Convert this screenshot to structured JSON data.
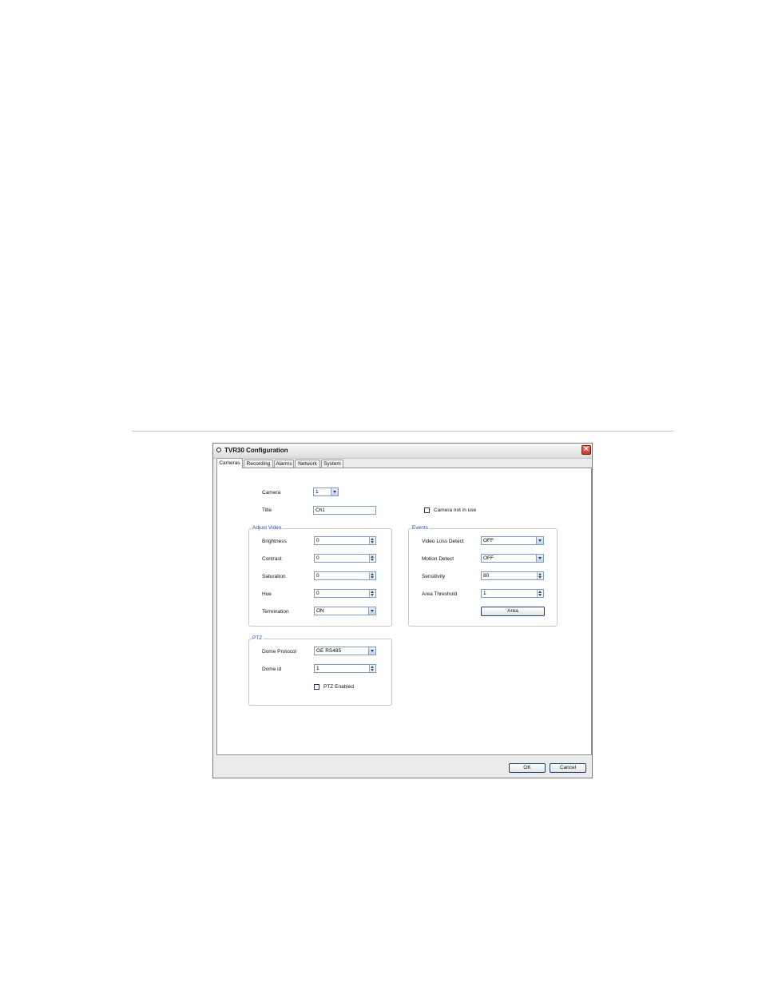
{
  "window": {
    "title": "TVR30 Configuration",
    "close_glyph": "✕"
  },
  "tabs": [
    {
      "label": "Cameras",
      "active": true
    },
    {
      "label": "Recording",
      "active": false
    },
    {
      "label": "Alarms",
      "active": false
    },
    {
      "label": "Network",
      "active": false
    },
    {
      "label": "System",
      "active": false
    }
  ],
  "camera": {
    "label": "Camera",
    "value": "1"
  },
  "title_field": {
    "label": "Title",
    "value": "Ch1"
  },
  "camera_not_in_use": {
    "label": "Camera not in use",
    "checked": false
  },
  "adjust_video": {
    "title": "Adjust Video",
    "brightness": {
      "label": "Brightness",
      "value": "0"
    },
    "contrast": {
      "label": "Contrast",
      "value": "0"
    },
    "saturation": {
      "label": "Saturation",
      "value": "0"
    },
    "hue": {
      "label": "Hue",
      "value": "0"
    },
    "termination": {
      "label": "Termination",
      "value": "ON"
    }
  },
  "events": {
    "title": "Events",
    "video_loss_detect": {
      "label": "Video Loss Detect",
      "value": "OFF"
    },
    "motion_detect": {
      "label": "Motion Detect",
      "value": "OFF"
    },
    "sensitivity": {
      "label": "Sensitivity",
      "value": "80"
    },
    "area_threshold": {
      "label": "Area Threshold",
      "value": "1"
    },
    "area_button": "Area"
  },
  "ptz": {
    "title": "PTZ",
    "dome_protocol": {
      "label": "Dome Protocol",
      "value": "GE RS485"
    },
    "dome_id": {
      "label": "Dome id",
      "value": "1"
    },
    "ptz_enabled": {
      "label": "PTZ Enabled",
      "checked": false
    }
  },
  "footer": {
    "ok": "OK",
    "cancel": "Cancel"
  }
}
